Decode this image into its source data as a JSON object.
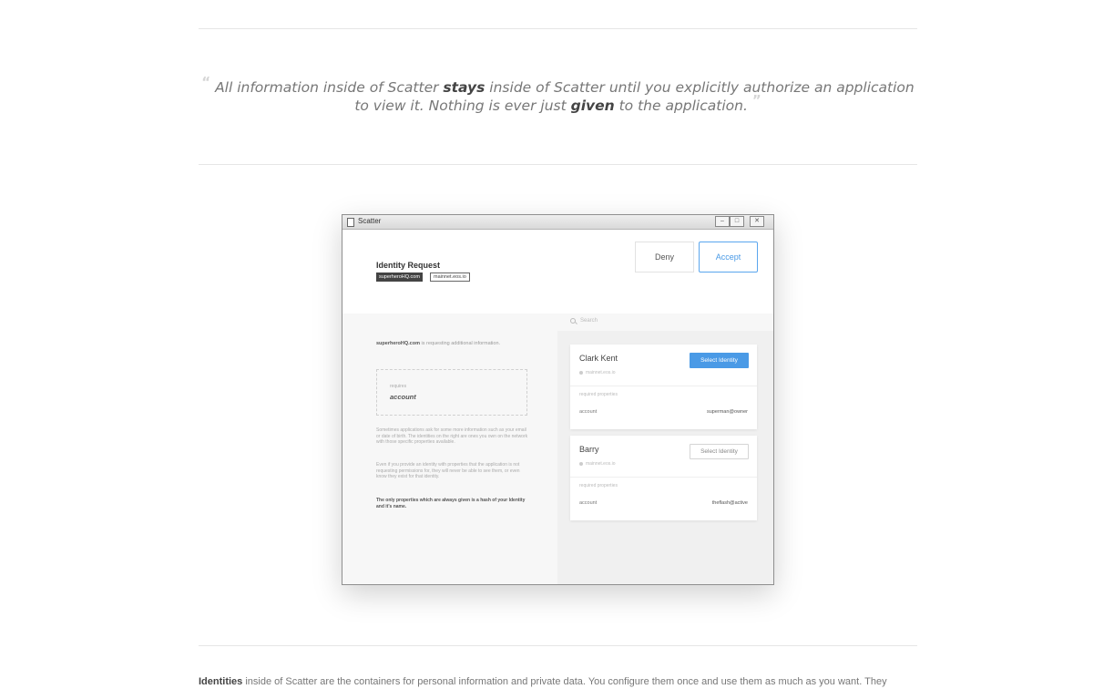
{
  "quote": {
    "part1": "All information inside of Scatter ",
    "bold1": "stays",
    "part2": " inside of Scatter until you explicitly authorize an application to view it. Nothing is ever just ",
    "bold2": "given",
    "part3": " to the application.",
    "open_mark": "“",
    "close_mark": "”"
  },
  "window": {
    "title": "Scatter",
    "controls": {
      "minimize": "–",
      "maximize": "□",
      "close": "✕"
    },
    "header": {
      "title": "Identity Request",
      "origin_tag": "superheroHQ.com",
      "network_tag": "mainnet.eos.io",
      "deny_label": "Deny",
      "accept_label": "Accept"
    },
    "left": {
      "requester": "superheroHQ.com",
      "requesting_text": " is requesting additional information.",
      "requires_label": "requires",
      "requires_value": "account",
      "para1": "Sometimes applications ask for some more information such as your email or date of birth. The identities on the right are ones you own on the network with those specific properties available.",
      "para2": "Even if you provide an identity with properties that the application is not requesting permissions for, they will never be able to see them, or even know they exist for that identity.",
      "para3": "The only properties which are always given is a hash of your Identity and it's name."
    },
    "right": {
      "search_placeholder": "Search",
      "identities": [
        {
          "name": "Clark Kent",
          "network": "mainnet.eos.io",
          "button": "Select Identity",
          "required_label": "required properties",
          "key": "account",
          "value": "superman@owner"
        },
        {
          "name": "Barry",
          "network": "mainnet.eos.io",
          "button": "Select Identity",
          "required_label": "required properties",
          "key": "account",
          "value": "theflash@active"
        }
      ]
    }
  },
  "bottom": {
    "bold": "Identities",
    "text": " inside of Scatter are the containers for personal information and private data. You configure them once and use them as much as you want. They"
  },
  "colors": {
    "accent": "#4a9ae6"
  }
}
